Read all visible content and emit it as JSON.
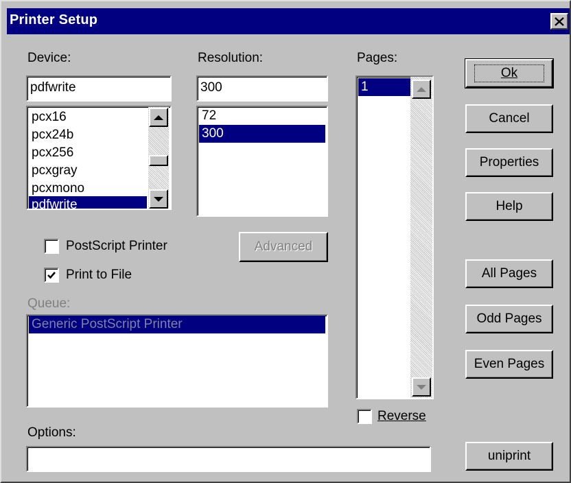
{
  "window": {
    "title": "Printer Setup",
    "close_glyph": "✕"
  },
  "device": {
    "label": "Device:",
    "value": "pdfwrite",
    "items": [
      "pcx16",
      "pcx24b",
      "pcx256",
      "pcxgray",
      "pcxmono",
      "pdfwrite"
    ],
    "selected": "pdfwrite"
  },
  "resolution": {
    "label": "Resolution:",
    "value": "300",
    "items": [
      "72",
      "300"
    ],
    "selected": "300"
  },
  "pages": {
    "label": "Pages:",
    "items": [
      "1"
    ],
    "selected": "1",
    "reverse_label": "Reverse",
    "reverse_checked": false
  },
  "checkboxes": {
    "postscript_label": "PostScript Printer",
    "postscript_checked": false,
    "print_to_file_label": "Print to File",
    "print_to_file_checked": true
  },
  "buttons": {
    "ok": "Ok",
    "cancel": "Cancel",
    "properties": "Properties",
    "help": "Help",
    "advanced": "Advanced",
    "all_pages": "All Pages",
    "odd_pages": "Odd Pages",
    "even_pages": "Even Pages",
    "uniprint": "uniprint"
  },
  "queue": {
    "label": "Queue:",
    "items": [
      "Generic PostScript Printer"
    ],
    "selected": "Generic PostScript Printer"
  },
  "options": {
    "label": "Options:",
    "value": ""
  },
  "colors": {
    "titlebar": "#000080",
    "face": "#c0c0c0",
    "selection": "#000080"
  }
}
